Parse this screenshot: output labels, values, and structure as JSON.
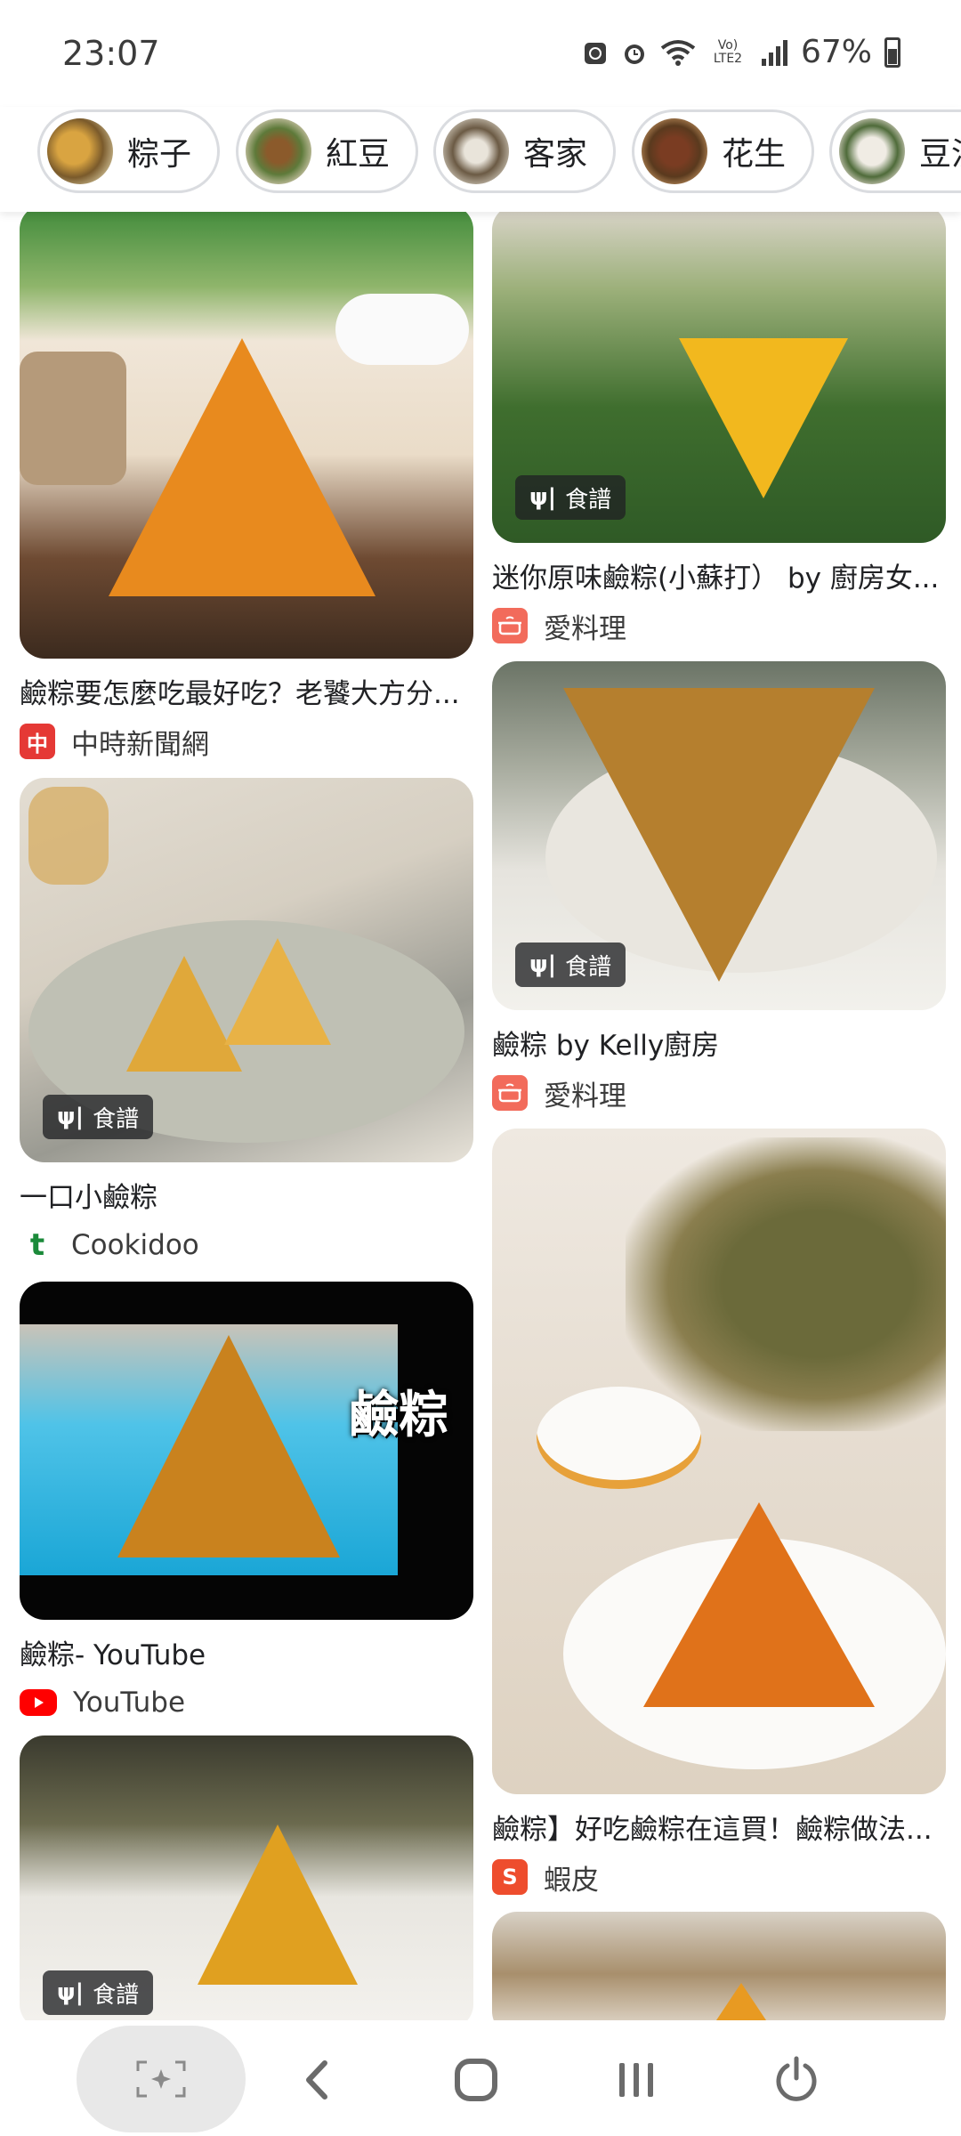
{
  "status_bar": {
    "time": "23:07",
    "network": "Vo) LTE2",
    "battery": "67%"
  },
  "chips": [
    {
      "label": "粽子"
    },
    {
      "label": "紅豆"
    },
    {
      "label": "客家"
    },
    {
      "label": "花生"
    },
    {
      "label": "豆沙"
    }
  ],
  "cards": {
    "c1": {
      "title": "鹼粽要怎麼吃最好吃？老饕大方分...",
      "source": "中時新聞網",
      "source_icon_text": "中"
    },
    "c2": {
      "badge": "食譜",
      "title": "迷你原味鹼粽(小蘇打） by 廚房女...",
      "source": "愛料理"
    },
    "c3": {
      "badge": "食譜",
      "title": "一口小鹼粽",
      "source": "Cookidoo",
      "source_icon_text": "t"
    },
    "c4": {
      "title": "鹼粽 by Kelly廚房",
      "badge": "食譜",
      "source": "愛料理"
    },
    "c5": {
      "overlay": "鹼粽",
      "title": "鹼粽- YouTube",
      "source": "YouTube"
    },
    "c6": {
      "title": "鹼粽】好吃鹼粽在這買！鹼粽做法...",
      "source": "蝦皮",
      "source_icon_text": "S"
    },
    "c7": {
      "badge": "食譜"
    }
  },
  "colors": {
    "chinatimes": "#e53935",
    "icook": "#f26b5b",
    "cookidoo": "#1b8a3a",
    "youtube": "#ff0000",
    "shopee": "#ee4d2d"
  }
}
